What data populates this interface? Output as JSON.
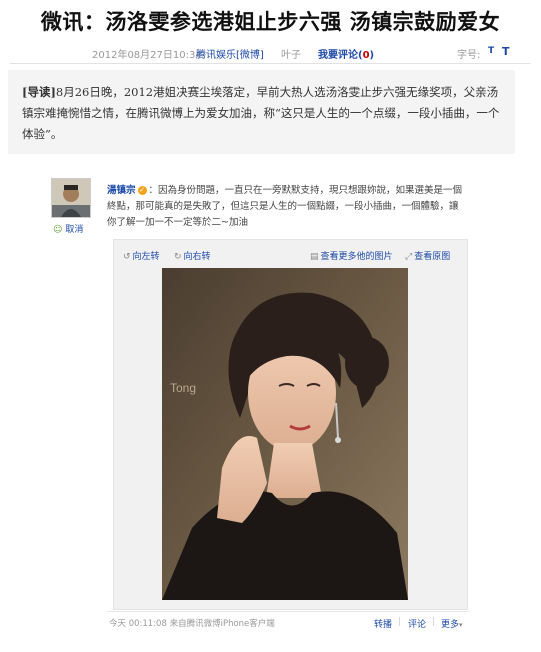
{
  "article": {
    "headline": "微讯：汤洛雯参选港姐止步六强 汤镇宗鼓励爱女",
    "meta": {
      "datetime": "2012年08月27日10:34",
      "source": "腾讯娱乐[微博]",
      "author": "叶子",
      "comment": "我要评论(",
      "comment_count": "0",
      "comment_close": ")",
      "font_label": "字号:",
      "font_small": "T",
      "font_large": "T"
    },
    "summary": {
      "tag": "[导读]",
      "text": "8月26日晚，2012港姐决赛尘埃落定，早前大热人选汤洛雯止步六强无缘奖项，父亲汤镇宗难掩惋惜之情，在腾讯微博上为爱女加油，称“这只是人生的一个点缀，一段小插曲，一个体验”。"
    }
  },
  "weibo": {
    "author": "湯镇宗",
    "text": "：因為身份問題，一直只在一旁默默支持，現只想跟妳說，如果選美是一個終點，那可能真的是失敗了，但這只是人生的一個點綴，一段小插曲，一個體驗，讓你了解一加一不一定等於二~加油",
    "cancel_label": "取消",
    "toolbar": {
      "rotate_left": "向左转",
      "rotate_right": "向右转",
      "more_images": "查看更多他的图片",
      "view_original": "查看原图"
    },
    "photo_watermark": "Tong",
    "footer": {
      "time": "今天 00:11:08 来自腾讯微博iPhone客户端",
      "repost": "转播",
      "comment": "评论",
      "more": "更多"
    }
  }
}
